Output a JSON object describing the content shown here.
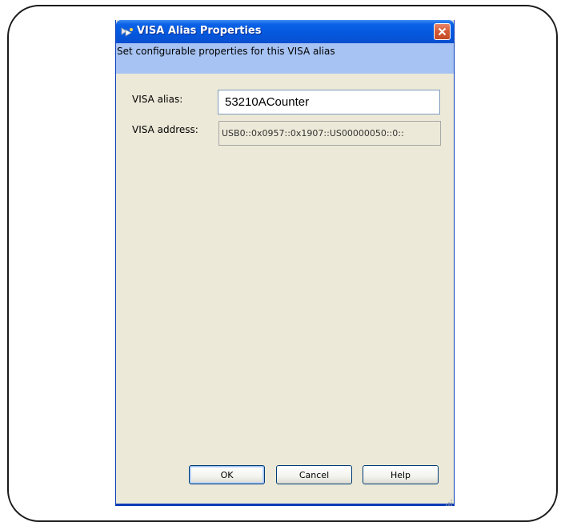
{
  "dialog": {
    "title": "VISA Alias Properties",
    "title_icon": "visa-app-icon",
    "close_icon": "close-icon",
    "banner_text": "Set configurable properties for this VISA alias"
  },
  "fields": {
    "alias_label": "VISA alias:",
    "alias_value": "53210ACounter",
    "address_label": "VISA address:",
    "address_value": "USB0::0x0957::0x1907::US00000050::0::"
  },
  "buttons": {
    "ok": "OK",
    "cancel": "Cancel",
    "help": "Help"
  },
  "colors": {
    "titlebar": "#0457dc",
    "banner": "#a7c3f3",
    "dialog_bg": "#ece9d8",
    "close_button": "#d45a36"
  }
}
